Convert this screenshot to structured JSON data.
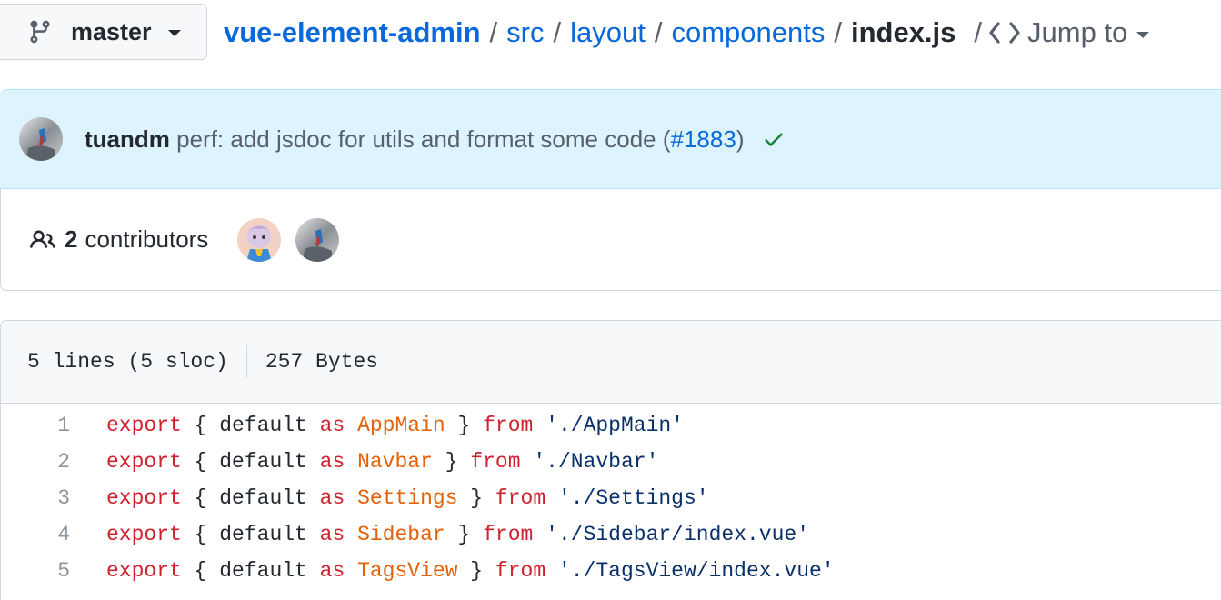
{
  "branch": {
    "name": "master"
  },
  "breadcrumb": {
    "repo": "vue-element-admin",
    "parts": [
      "src",
      "layout",
      "components"
    ],
    "file": "index.js",
    "separator": "/",
    "jump_label": "Jump to"
  },
  "commit": {
    "author": "tuandm",
    "message": "perf: add jsdoc for utils and format some code (",
    "pr": "#1883",
    "message_end": ")",
    "status": "success"
  },
  "contributors": {
    "count": "2",
    "label": "contributors"
  },
  "file_info": {
    "lines": "5 lines (5 sloc)",
    "size": "257 Bytes"
  },
  "code": {
    "lines": [
      {
        "num": "1",
        "kw1": "export",
        "p1": " { default ",
        "kw2": "as",
        "name": "AppMain",
        "p2": " } ",
        "kw3": "from",
        "str": "'./AppMain'"
      },
      {
        "num": "2",
        "kw1": "export",
        "p1": " { default ",
        "kw2": "as",
        "name": "Navbar",
        "p2": " } ",
        "kw3": "from",
        "str": "'./Navbar'"
      },
      {
        "num": "3",
        "kw1": "export",
        "p1": " { default ",
        "kw2": "as",
        "name": "Settings",
        "p2": " } ",
        "kw3": "from",
        "str": "'./Settings'"
      },
      {
        "num": "4",
        "kw1": "export",
        "p1": " { default ",
        "kw2": "as",
        "name": "Sidebar",
        "p2": " } ",
        "kw3": "from",
        "str": "'./Sidebar/index.vue'"
      },
      {
        "num": "5",
        "kw1": "export",
        "p1": " { default ",
        "kw2": "as",
        "name": "TagsView",
        "p2": " } ",
        "kw3": "from",
        "str": "'./TagsView/index.vue'"
      }
    ]
  },
  "colors": {
    "link": "#0969da",
    "keyword": "#cf222e",
    "entity": "#e36209",
    "string": "#0a3069",
    "commit_bg": "#ddf4ff",
    "success": "#1a7f37"
  }
}
